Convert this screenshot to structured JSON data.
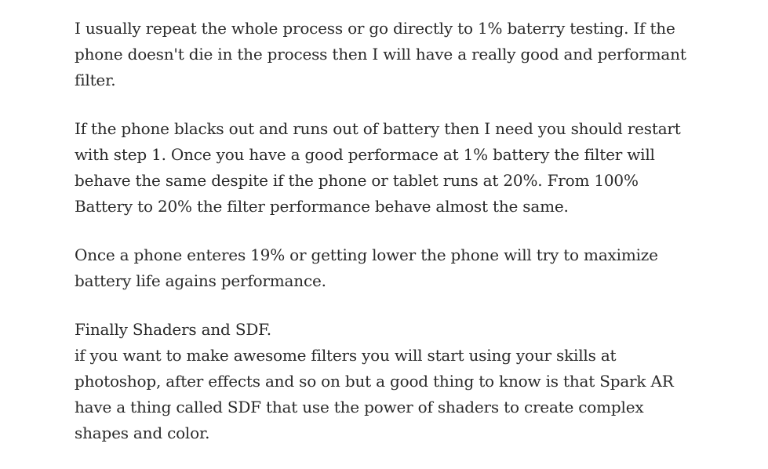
{
  "article": {
    "paragraphs": [
      {
        "lines": [
          "I usually repeat the whole process or go directly to 1% baterry testing. If the",
          "phone doesn't die in the process then I will have a really good and performant",
          "filter."
        ]
      },
      {
        "lines": [
          "If the phone blacks out and runs out of battery then I need you should restart",
          "with step 1. Once you have a good performace at 1% battery the filter will",
          "behave the same despite if the phone or tablet runs at 20%. From 100%",
          "Battery to 20% the filter performance behave almost the same."
        ]
      },
      {
        "lines": [
          "Once a phone enteres 19% or getting lower the phone will try to maximize",
          "battery life agains performance."
        ]
      },
      {
        "lines": [
          "Finally Shaders and SDF.",
          "if you want to make awesome filters you will start using your skills at",
          "photoshop, after effects and so on but a good thing to know is that Spark AR",
          "have a thing called SDF that use the power of shaders to create complex",
          "shapes and color."
        ]
      }
    ]
  }
}
